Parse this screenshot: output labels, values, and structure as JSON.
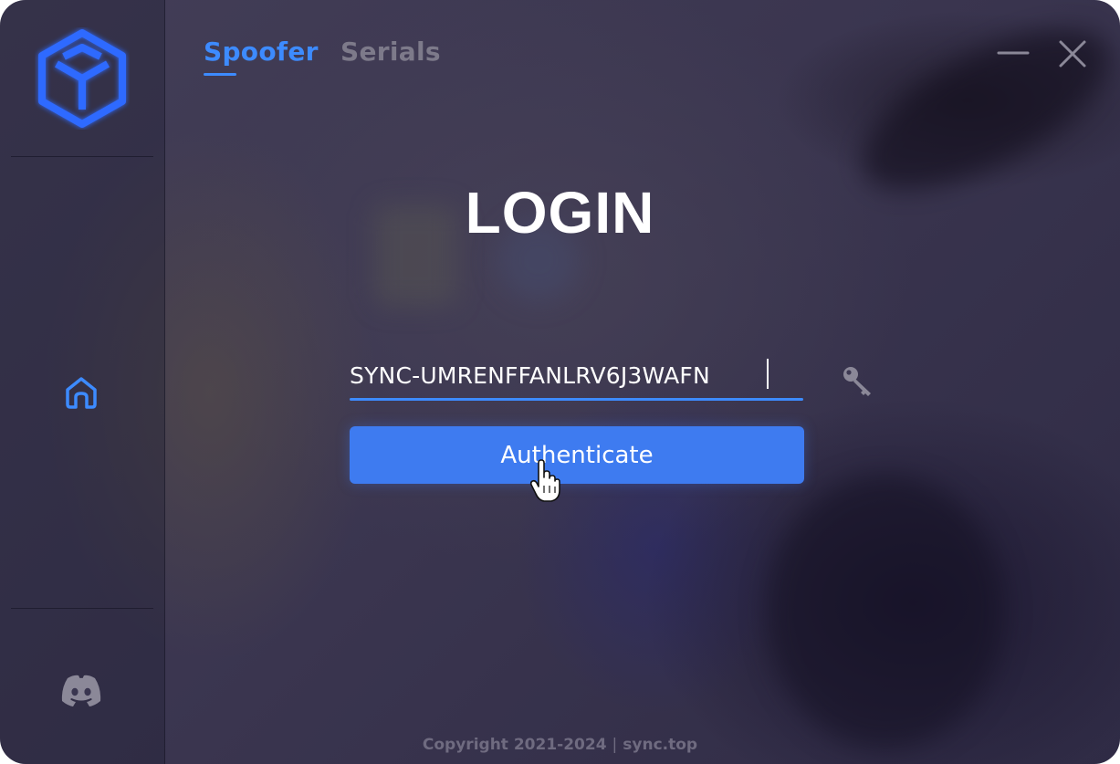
{
  "header": {
    "tabs": [
      {
        "label": "Spoofer",
        "active": true
      },
      {
        "label": "Serials",
        "active": false
      }
    ]
  },
  "sidebar": {
    "items": [
      {
        "icon": "home-icon",
        "active": true
      },
      {
        "icon": "discord-icon",
        "active": false
      }
    ]
  },
  "window_controls": [
    "minimize-icon",
    "close-icon"
  ],
  "login": {
    "title": "LOGIN",
    "license_key_value": "SYNC-UMRENFFANLRV6J3WAFN",
    "key_icon": "key-icon",
    "authenticate_label": "Authenticate"
  },
  "footer": {
    "copyright": "Copyright 2021-2024",
    "separator": "|",
    "site": "sync.top"
  },
  "colors": {
    "accent": "#3d8bff",
    "button": "#3e7bf0",
    "inactive_tab": "#7d7a8a"
  }
}
